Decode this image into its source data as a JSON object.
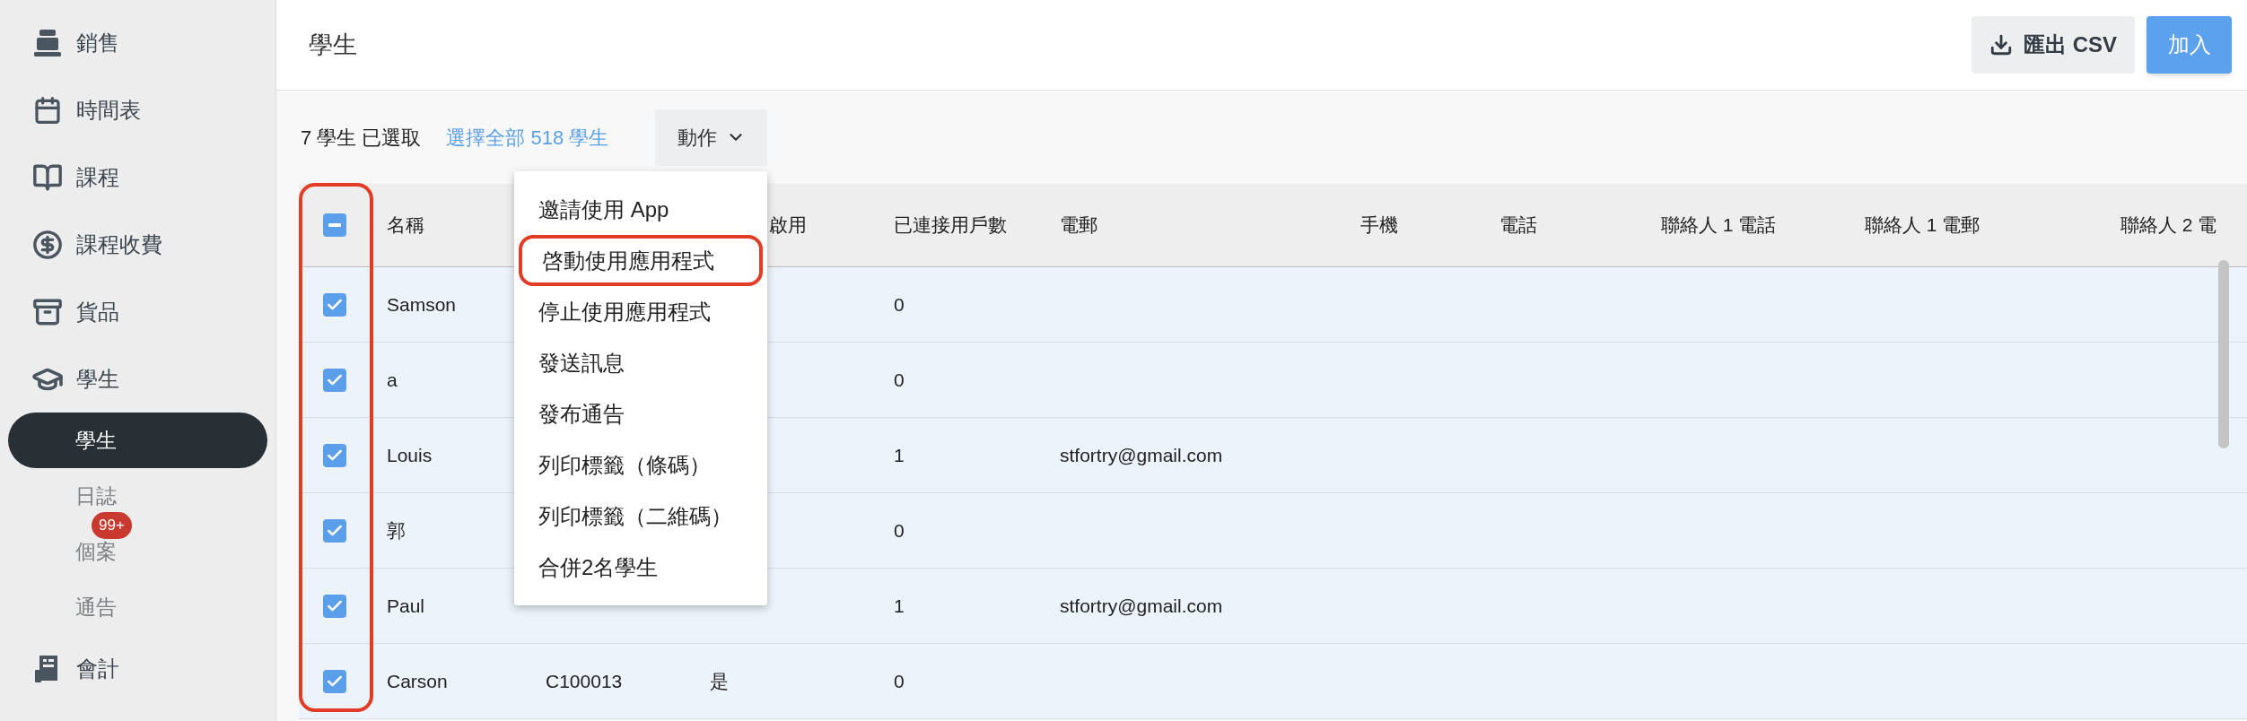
{
  "sidebar": {
    "items": [
      {
        "label": "銷售",
        "kind": "main",
        "selected": false
      },
      {
        "label": "時間表",
        "kind": "main",
        "selected": false
      },
      {
        "label": "課程",
        "kind": "main",
        "selected": false
      },
      {
        "label": "課程收費",
        "kind": "main",
        "selected": false
      },
      {
        "label": "貨品",
        "kind": "main",
        "selected": false
      },
      {
        "label": "學生",
        "kind": "main",
        "selected": false
      },
      {
        "label": "學生",
        "kind": "sub",
        "selected": true
      },
      {
        "label": "日誌",
        "kind": "sub",
        "selected": false
      },
      {
        "label": "個案",
        "kind": "sub",
        "selected": false,
        "badge": "99+"
      },
      {
        "label": "通告",
        "kind": "sub",
        "selected": false
      },
      {
        "label": "會計",
        "kind": "main",
        "selected": false
      }
    ]
  },
  "header": {
    "title": "學生",
    "buttons": [
      {
        "label": "匯出 CSV",
        "kind": "export"
      },
      {
        "label": "加入",
        "kind": "primary"
      }
    ]
  },
  "toolbar": {
    "selection": "7 學生 已選取",
    "select_all_link": "選擇全部 518 學生",
    "actions_button": "動作"
  },
  "actions_menu": {
    "items": [
      {
        "label": "邀請使用 App",
        "circled": false
      },
      {
        "label": "啓動使用應用程式",
        "circled": true
      },
      {
        "label": "停止使用應用程式",
        "circled": false
      },
      {
        "label": "發送訊息",
        "circled": false
      },
      {
        "label": "發布通告",
        "circled": false
      },
      {
        "label": "列印標籤（條碼）",
        "circled": false
      },
      {
        "label": "列印標籤（二維碼）",
        "circled": false
      },
      {
        "label": "合併2名學生",
        "circled": false
      }
    ]
  },
  "table": {
    "header_checkbox": {
      "mixed": true,
      "circled": true
    },
    "columns": [
      "名稱",
      "啟用",
      "已連接用戶數",
      "電郵",
      "手機",
      "電話",
      "聯絡人 1 電話",
      "聯絡人 1 電郵",
      "聯絡人 2 電"
    ],
    "rows": [
      {
        "checked": true,
        "name": "Samson",
        "connected_users": "0"
      },
      {
        "checked": true,
        "name": "a",
        "connected_users": "0"
      },
      {
        "checked": true,
        "name": "Louis",
        "connected_users": "1",
        "email": "stfortry@gmail.com"
      },
      {
        "checked": true,
        "name": "郭",
        "connected_users": "0"
      },
      {
        "checked": true,
        "name": "Paul",
        "connected_users": "1",
        "email": "stfortry@gmail.com"
      },
      {
        "checked": true,
        "name": "Carson",
        "column_2": "C100013",
        "enabled": "是",
        "connected_users": "0"
      }
    ]
  }
}
